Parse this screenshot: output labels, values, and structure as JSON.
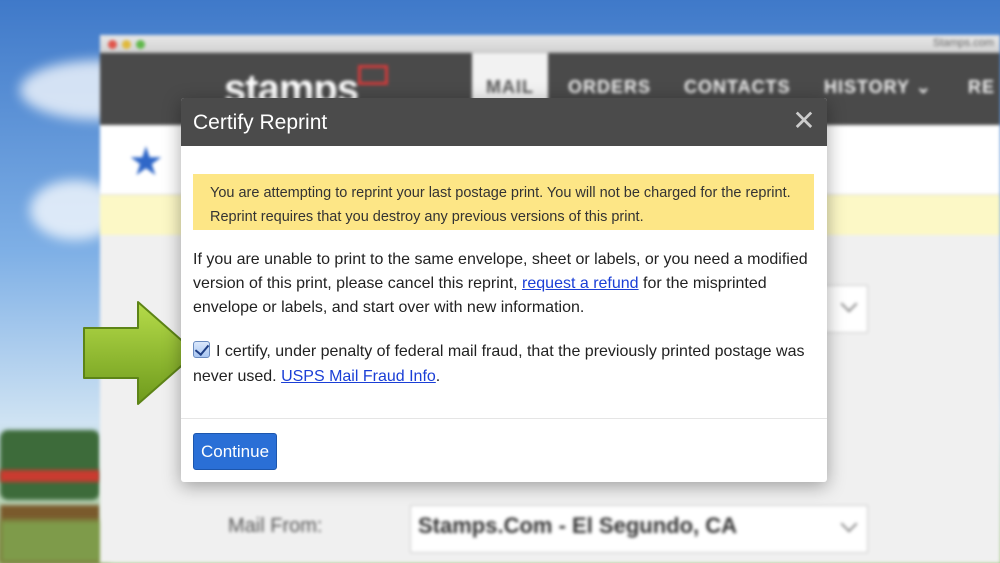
{
  "background": {
    "window_title": "Stamps.com",
    "logo_text": "stamps",
    "nav": [
      {
        "label": "MAIL"
      },
      {
        "label": "ORDERS"
      },
      {
        "label": "CONTACTS"
      },
      {
        "label": "HISTORY ⌄"
      },
      {
        "label": "RE"
      }
    ],
    "mail_from_label": "Mail From:",
    "mail_from_value": "Stamps.Com - El Segundo, CA"
  },
  "modal": {
    "title": "Certify Reprint",
    "close_symbol": "✕",
    "alert_text": "You are attempting to reprint your last postage print. You will not be charged for the reprint. Reprint requires that you destroy any previous versions of this print.",
    "body_text_before_link": "If you are unable to print to the same envelope, sheet or labels, or you need a modified version of this print, please cancel this reprint, ",
    "refund_link": "request a refund",
    "body_text_after_link": " for the misprinted envelope or labels, and start over with new information.",
    "certify_checked": true,
    "certify_text": "I certify, under penalty of federal mail fraud, that the previously printed postage was never used. ",
    "fraud_link": "USPS Mail Fraud Info",
    "certify_period": ".",
    "continue_label": "Continue"
  },
  "colors": {
    "modal_header": "#4b4b4b",
    "alert_bg": "#fde686",
    "link": "#1a3ed6",
    "primary_button": "#2a6fd6",
    "arrow": "#8fbe2e"
  },
  "icons": [
    "close-icon",
    "star-icon",
    "checkbox-checked-icon",
    "arrow-right-icon"
  ]
}
